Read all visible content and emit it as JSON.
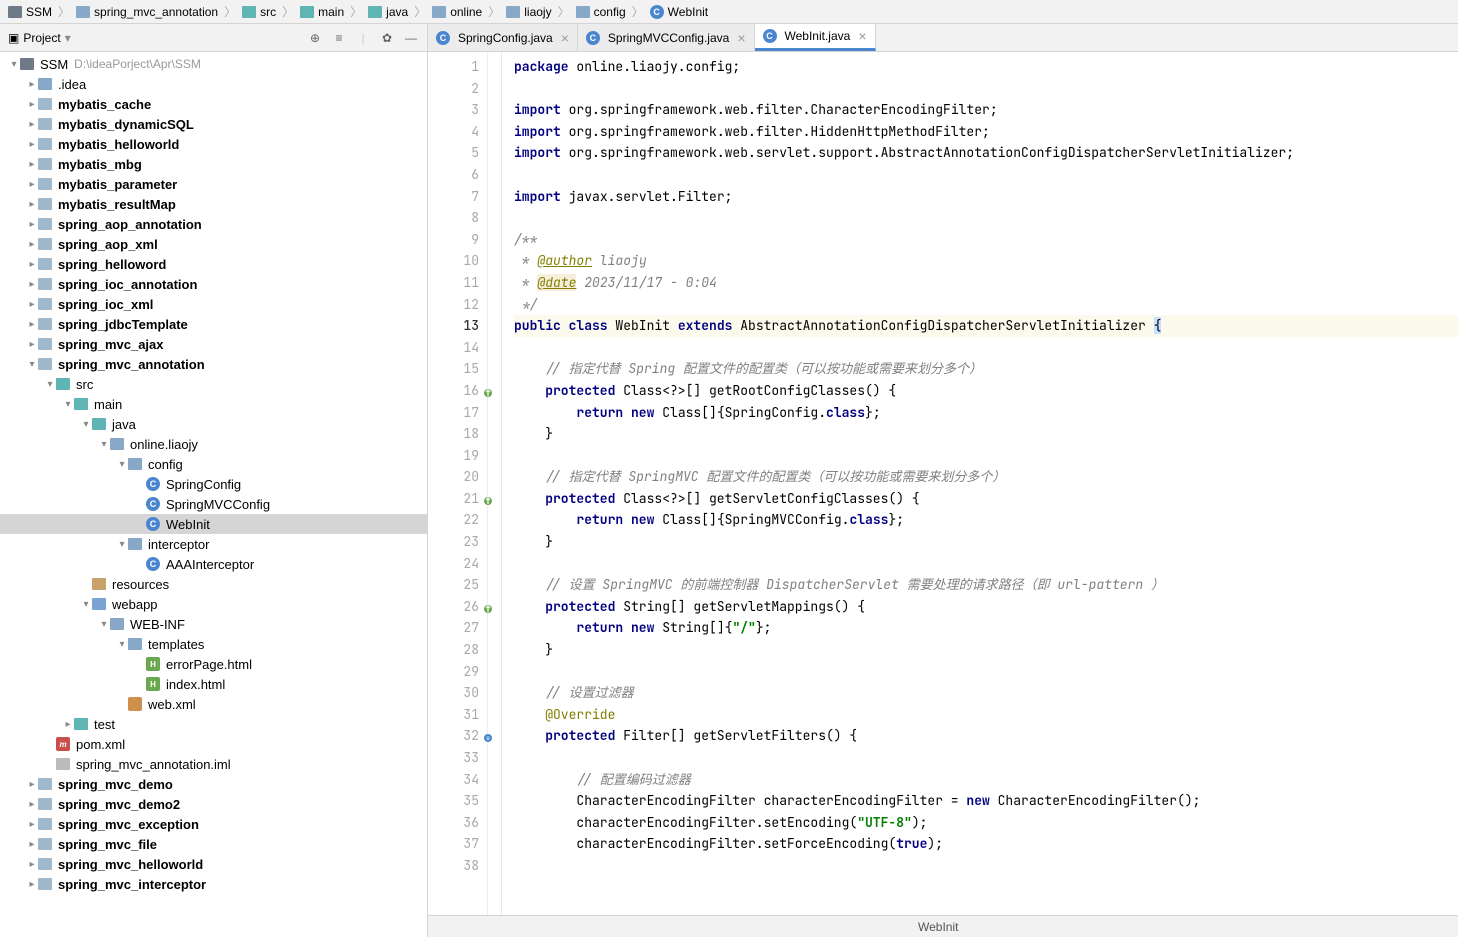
{
  "breadcrumb": [
    {
      "text": "SSM",
      "icon": "folder-dark"
    },
    {
      "text": "spring_mvc_annotation",
      "icon": "folder"
    },
    {
      "text": "src",
      "icon": "folder-teal"
    },
    {
      "text": "main",
      "icon": "folder-teal"
    },
    {
      "text": "java",
      "icon": "folder-teal"
    },
    {
      "text": "online",
      "icon": "folder"
    },
    {
      "text": "liaojy",
      "icon": "folder"
    },
    {
      "text": "config",
      "icon": "folder"
    },
    {
      "text": "WebInit",
      "icon": "class"
    }
  ],
  "projectPanel": {
    "title": "Project",
    "tree": [
      {
        "depth": 0,
        "arrow": "down",
        "icon": "folder-dark",
        "label": "SSM",
        "path": "D:\\ideaPorject\\Apr\\SSM"
      },
      {
        "depth": 1,
        "arrow": "right",
        "icon": "folder",
        "label": ".idea"
      },
      {
        "depth": 1,
        "arrow": "right",
        "icon": "module",
        "label": "mybatis_cache",
        "bold": true
      },
      {
        "depth": 1,
        "arrow": "right",
        "icon": "module",
        "label": "mybatis_dynamicSQL",
        "bold": true
      },
      {
        "depth": 1,
        "arrow": "right",
        "icon": "module",
        "label": "mybatis_helloworld",
        "bold": true
      },
      {
        "depth": 1,
        "arrow": "right",
        "icon": "module",
        "label": "mybatis_mbg",
        "bold": true
      },
      {
        "depth": 1,
        "arrow": "right",
        "icon": "module",
        "label": "mybatis_parameter",
        "bold": true
      },
      {
        "depth": 1,
        "arrow": "right",
        "icon": "module",
        "label": "mybatis_resultMap",
        "bold": true
      },
      {
        "depth": 1,
        "arrow": "right",
        "icon": "module",
        "label": "spring_aop_annotation",
        "bold": true
      },
      {
        "depth": 1,
        "arrow": "right",
        "icon": "module",
        "label": "spring_aop_xml",
        "bold": true
      },
      {
        "depth": 1,
        "arrow": "right",
        "icon": "module",
        "label": "spring_helloword",
        "bold": true
      },
      {
        "depth": 1,
        "arrow": "right",
        "icon": "module",
        "label": "spring_ioc_annotation",
        "bold": true
      },
      {
        "depth": 1,
        "arrow": "right",
        "icon": "module",
        "label": "spring_ioc_xml",
        "bold": true
      },
      {
        "depth": 1,
        "arrow": "right",
        "icon": "module",
        "label": "spring_jdbcTemplate",
        "bold": true
      },
      {
        "depth": 1,
        "arrow": "right",
        "icon": "module",
        "label": "spring_mvc_ajax",
        "bold": true
      },
      {
        "depth": 1,
        "arrow": "down",
        "icon": "module",
        "label": "spring_mvc_annotation",
        "bold": true
      },
      {
        "depth": 2,
        "arrow": "down",
        "icon": "folder-teal",
        "label": "src"
      },
      {
        "depth": 3,
        "arrow": "down",
        "icon": "folder-teal",
        "label": "main"
      },
      {
        "depth": 4,
        "arrow": "down",
        "icon": "folder-teal",
        "label": "java"
      },
      {
        "depth": 5,
        "arrow": "down",
        "icon": "folder",
        "label": "online.liaojy"
      },
      {
        "depth": 6,
        "arrow": "down",
        "icon": "folder",
        "label": "config"
      },
      {
        "depth": 7,
        "arrow": "",
        "icon": "class",
        "label": "SpringConfig"
      },
      {
        "depth": 7,
        "arrow": "",
        "icon": "class",
        "label": "SpringMVCConfig"
      },
      {
        "depth": 7,
        "arrow": "",
        "icon": "class",
        "label": "WebInit",
        "selected": true
      },
      {
        "depth": 6,
        "arrow": "down",
        "icon": "folder",
        "label": "interceptor"
      },
      {
        "depth": 7,
        "arrow": "",
        "icon": "class",
        "label": "AAAInterceptor"
      },
      {
        "depth": 4,
        "arrow": "",
        "icon": "folder-res",
        "label": "resources"
      },
      {
        "depth": 4,
        "arrow": "down",
        "icon": "folder-web",
        "label": "webapp"
      },
      {
        "depth": 5,
        "arrow": "down",
        "icon": "folder",
        "label": "WEB-INF"
      },
      {
        "depth": 6,
        "arrow": "down",
        "icon": "folder",
        "label": "templates"
      },
      {
        "depth": 7,
        "arrow": "",
        "icon": "html",
        "label": "errorPage.html"
      },
      {
        "depth": 7,
        "arrow": "",
        "icon": "html",
        "label": "index.html"
      },
      {
        "depth": 6,
        "arrow": "",
        "icon": "xml",
        "label": "web.xml"
      },
      {
        "depth": 3,
        "arrow": "right",
        "icon": "folder-teal",
        "label": "test"
      },
      {
        "depth": 2,
        "arrow": "",
        "icon": "mvn",
        "label": "pom.xml"
      },
      {
        "depth": 2,
        "arrow": "",
        "icon": "file",
        "label": "spring_mvc_annotation.iml"
      },
      {
        "depth": 1,
        "arrow": "right",
        "icon": "module",
        "label": "spring_mvc_demo",
        "bold": true
      },
      {
        "depth": 1,
        "arrow": "right",
        "icon": "module",
        "label": "spring_mvc_demo2",
        "bold": true
      },
      {
        "depth": 1,
        "arrow": "right",
        "icon": "module",
        "label": "spring_mvc_exception",
        "bold": true
      },
      {
        "depth": 1,
        "arrow": "right",
        "icon": "module",
        "label": "spring_mvc_file",
        "bold": true
      },
      {
        "depth": 1,
        "arrow": "right",
        "icon": "module",
        "label": "spring_mvc_helloworld",
        "bold": true
      },
      {
        "depth": 1,
        "arrow": "right",
        "icon": "module",
        "label": "spring_mvc_interceptor",
        "bold": true
      }
    ]
  },
  "tabs": [
    {
      "label": "SpringConfig.java",
      "active": false
    },
    {
      "label": "SpringMVCConfig.java",
      "active": false
    },
    {
      "label": "WebInit.java",
      "active": true
    }
  ],
  "code": {
    "lines": [
      {
        "n": 1,
        "html": "<span class='kw'>package</span> online.liaojy.config;"
      },
      {
        "n": 2,
        "html": ""
      },
      {
        "n": 3,
        "html": "<span class='kw'>import</span> org.springframework.web.filter.CharacterEncodingFilter;"
      },
      {
        "n": 4,
        "html": "<span class='kw'>import</span> org.springframework.web.filter.HiddenHttpMethodFilter;"
      },
      {
        "n": 5,
        "html": "<span class='kw'>import</span> org.springframework.web.servlet.support.AbstractAnnotationConfigDispatcherServletInitializer;"
      },
      {
        "n": 6,
        "html": ""
      },
      {
        "n": 7,
        "html": "<span class='kw'>import</span> javax.servlet.Filter;"
      },
      {
        "n": 8,
        "html": ""
      },
      {
        "n": 9,
        "html": "<span class='cmt'>/**</span>"
      },
      {
        "n": 10,
        "html": "<span class='cmt'> * </span><span class='ann-u'>@author</span><span class='cmt'> liaojy</span>"
      },
      {
        "n": 11,
        "html": "<span class='cmt'> * </span><span class='ann-u' style='background:#f7efdc'>@date</span><span class='cmt'> 2023/11/17 - 0:04</span>"
      },
      {
        "n": 12,
        "html": "<span class='cmt'> */</span>"
      },
      {
        "n": 13,
        "hl": true,
        "html": "<span class='kw'>public class</span> WebInit <span class='kw'>extends</span> AbstractAnnotationConfigDispatcherServletInitializer <span class='highlight-caret'>{</span>"
      },
      {
        "n": 14,
        "html": ""
      },
      {
        "n": 15,
        "html": "    <span class='cmt'>// 指定代替 Spring 配置文件的配置类（可以按功能或需要来划分多个）</span>"
      },
      {
        "n": 16,
        "mark": "override-up",
        "html": "    <span class='kw'>protected</span> Class&lt;?&gt;[] getRootConfigClasses() {"
      },
      {
        "n": 17,
        "html": "        <span class='kw'>return new</span> Class[]{SpringConfig.<span class='kw'>class</span>};"
      },
      {
        "n": 18,
        "html": "    }"
      },
      {
        "n": 19,
        "html": ""
      },
      {
        "n": 20,
        "html": "    <span class='cmt'>// 指定代替 SpringMVC 配置文件的配置类（可以按功能或需要来划分多个）</span>"
      },
      {
        "n": 21,
        "mark": "override-up",
        "html": "    <span class='kw'>protected</span> Class&lt;?&gt;[] getServletConfigClasses() {"
      },
      {
        "n": 22,
        "html": "        <span class='kw'>return new</span> Class[]{SpringMVCConfig.<span class='kw'>class</span>};"
      },
      {
        "n": 23,
        "html": "    }"
      },
      {
        "n": 24,
        "html": ""
      },
      {
        "n": 25,
        "html": "    <span class='cmt'>// 设置 SpringMVC 的前端控制器 DispatcherServlet 需要处理的请求路径（即 url-pattern ）</span>"
      },
      {
        "n": 26,
        "mark": "override-up",
        "html": "    <span class='kw'>protected</span> String[] getServletMappings() {"
      },
      {
        "n": 27,
        "html": "        <span class='kw'>return new</span> String[]{<span class='str'>\"/\"</span>};"
      },
      {
        "n": 28,
        "html": "    }"
      },
      {
        "n": 29,
        "html": ""
      },
      {
        "n": 30,
        "html": "    <span class='cmt'>// 设置过滤器</span>"
      },
      {
        "n": 31,
        "html": "    <span class='ann'>@Override</span>"
      },
      {
        "n": 32,
        "mark": "override",
        "html": "    <span class='kw'>protected</span> Filter[] getServletFilters() {"
      },
      {
        "n": 33,
        "html": ""
      },
      {
        "n": 34,
        "html": "        <span class='cmt'>// 配置编码过滤器</span>"
      },
      {
        "n": 35,
        "html": "        CharacterEncodingFilter characterEncodingFilter = <span class='kw'>new</span> CharacterEncodingFilter();"
      },
      {
        "n": 36,
        "html": "        characterEncodingFilter.setEncoding(<span class='str'>\"UTF-8\"</span>);"
      },
      {
        "n": 37,
        "html": "        characterEncodingFilter.setForceEncoding(<span class='kw'>true</span>);"
      },
      {
        "n": 38,
        "html": ""
      }
    ]
  },
  "status": "WebInit"
}
